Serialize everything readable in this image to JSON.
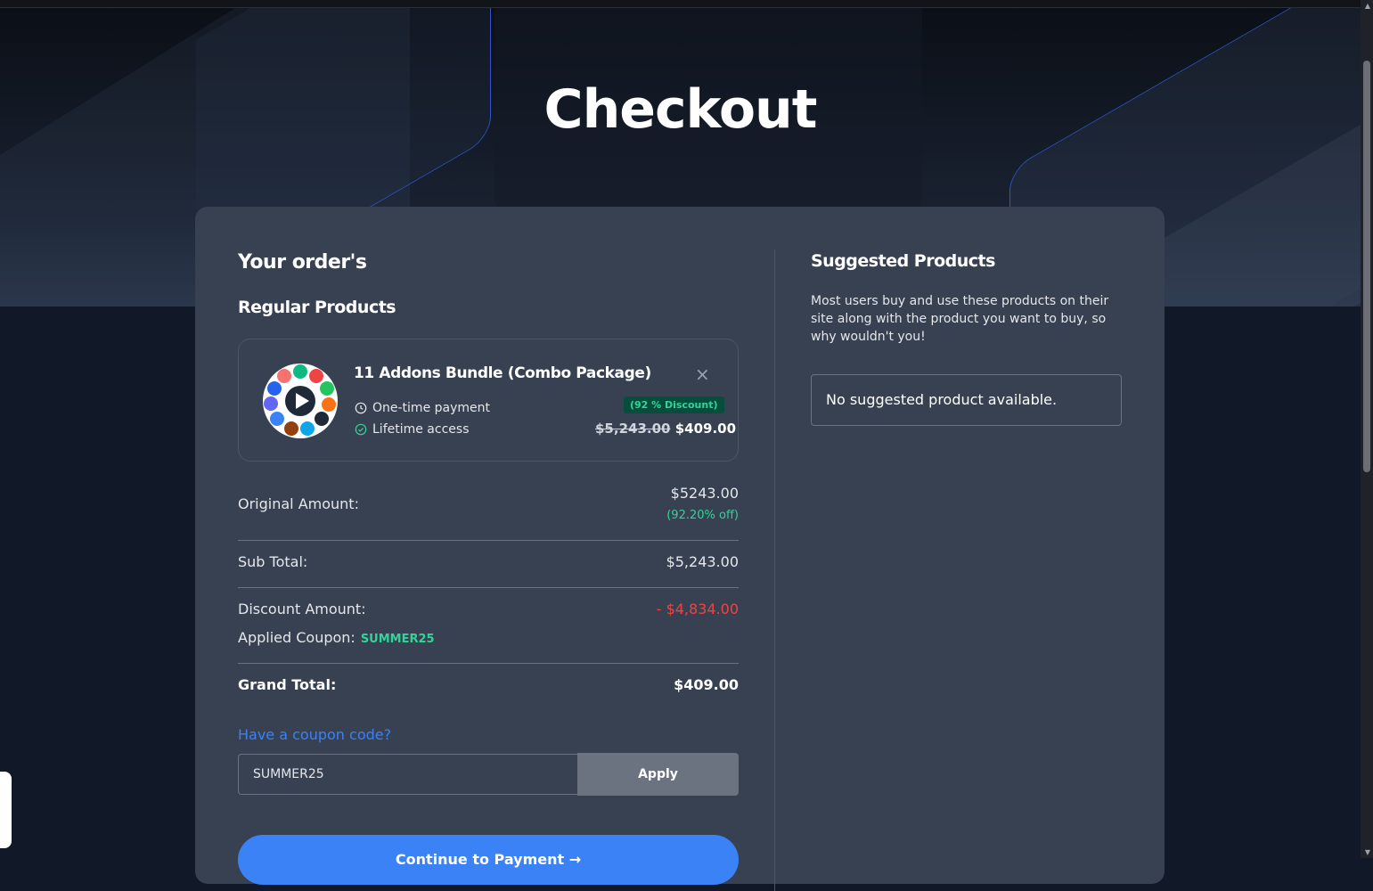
{
  "page": {
    "title": "Checkout"
  },
  "order": {
    "heading": "Your order's",
    "regular_heading": "Regular Products",
    "product": {
      "name": "11 Addons Bundle (Combo Package)",
      "feature_1": "One-time payment",
      "feature_2": "Lifetime access",
      "discount_badge": "(92 % Discount)",
      "old_price": "$5,243.00",
      "new_price": "$409.00",
      "close_symbol": "×"
    },
    "summary": {
      "original_label": "Original Amount:",
      "original_value": "$5243.00",
      "original_off": "(92.20% off)",
      "subtotal_label": "Sub Total:",
      "subtotal_value": "$5,243.00",
      "discount_label": "Discount Amount:",
      "discount_value": "- $4,834.00",
      "coupon_label": "Applied Coupon:",
      "coupon_code": "SUMMER25",
      "grand_label": "Grand Total:",
      "grand_value": "$409.00"
    },
    "coupon": {
      "link": "Have a coupon code?",
      "input_value": "SUMMER25",
      "apply": "Apply"
    },
    "pay_button": "Continue to Payment →"
  },
  "suggested": {
    "heading": "Suggested Products",
    "description": "Most users buy and use these products on their site along with the product you want to buy, so why wouldn't you!",
    "empty": "No suggested product available."
  },
  "icons": {
    "clock": "clock-icon",
    "check": "check-circle-icon",
    "close": "close-icon",
    "logo": "addons-bundle-logo"
  },
  "colors": {
    "accent": "#3b82f6",
    "success": "#34d399",
    "danger": "#ef4444",
    "card": "#374151"
  }
}
